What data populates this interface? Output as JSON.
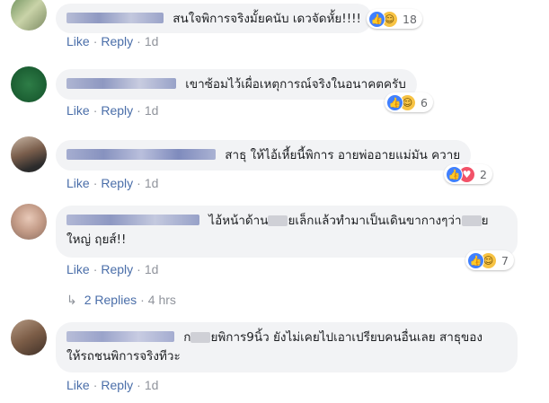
{
  "comments": [
    {
      "text": "สนใจพิการจริงมั้ยคนับ เดวจัดหั้ย!!!!",
      "line2": "",
      "reaction_count": "18",
      "actions": {
        "like": "Like",
        "reply": "Reply",
        "time": "1d"
      }
    },
    {
      "text": "เขาซ้อมไว้เผื่อเหตุการณ์จริงในอนาคตครับ",
      "line2": "",
      "reaction_count": "6",
      "actions": {
        "like": "Like",
        "reply": "Reply",
        "time": "1d"
      }
    },
    {
      "text": "สาธุ ให้ไอ้เหี้ยนี้พิการ อายพ่ออายแม่มัน ควาย",
      "line2": "",
      "reaction_count": "2",
      "actions": {
        "like": "Like",
        "reply": "Reply",
        "time": "1d"
      }
    },
    {
      "text_a": "ไอ้หน้าด้าน",
      "text_b": "ยเล็กแล้วทำมาเป็นเดินขากางๆว่า",
      "text_c": "ย",
      "line2": "ใหญ่ ฤยส์!!",
      "reaction_count": "7",
      "actions": {
        "like": "Like",
        "reply": "Reply",
        "time": "1d"
      }
    },
    {
      "text_a": "ก",
      "text_b": "ยพิการ9นิ้ว ยังไม่เคยไปเอาเปรียบคนอื่นเลย สาธุของ",
      "line2": "ให้รถชนพิการจริงทีวะ",
      "actions": {
        "like": "Like",
        "reply": "Reply",
        "time": "1d"
      }
    }
  ],
  "replies": {
    "label": "2 Replies",
    "time": "4 hrs"
  },
  "colors": {
    "link": "#4a6ea9",
    "bubble": "#f2f3f5",
    "like": "#4080ff",
    "haha": "#f7c344",
    "love": "#f25268"
  }
}
